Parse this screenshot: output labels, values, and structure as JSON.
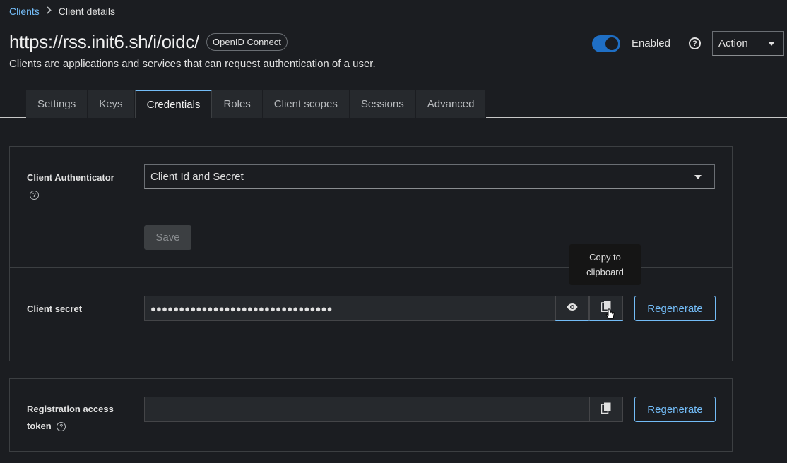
{
  "breadcrumb": {
    "parent": "Clients",
    "current": "Client details"
  },
  "header": {
    "title": "https://rss.init6.sh/i/oidc/",
    "badge": "OpenID Connect",
    "subtitle": "Clients are applications and services that can request authentication of a user.",
    "enabled_label": "Enabled",
    "enabled": true,
    "help_glyph": "?",
    "action_label": "Action"
  },
  "tabs": [
    {
      "label": "Settings"
    },
    {
      "label": "Keys"
    },
    {
      "label": "Credentials",
      "active": true
    },
    {
      "label": "Roles"
    },
    {
      "label": "Client scopes"
    },
    {
      "label": "Sessions"
    },
    {
      "label": "Advanced"
    }
  ],
  "credentials": {
    "authenticator_label": "Client Authenticator",
    "authenticator_value": "Client Id and Secret",
    "save_label": "Save",
    "secret_label": "Client secret",
    "secret_value": "●●●●●●●●●●●●●●●●●●●●●●●●●●●●●●●●",
    "regenerate_label": "Regenerate",
    "tooltip": "Copy to clipboard",
    "registration_label_1": "Registration access",
    "registration_label_2": "token",
    "registration_value": "",
    "help_glyph": "?"
  },
  "colors": {
    "accent": "#73bcf7",
    "toggle_on": "#1f6fc5",
    "background": "#1b1d21"
  },
  "icons": [
    "chevron-right-icon",
    "help-icon",
    "caret-down-icon",
    "eye-icon",
    "copy-icon",
    "pointer-cursor-icon"
  ]
}
